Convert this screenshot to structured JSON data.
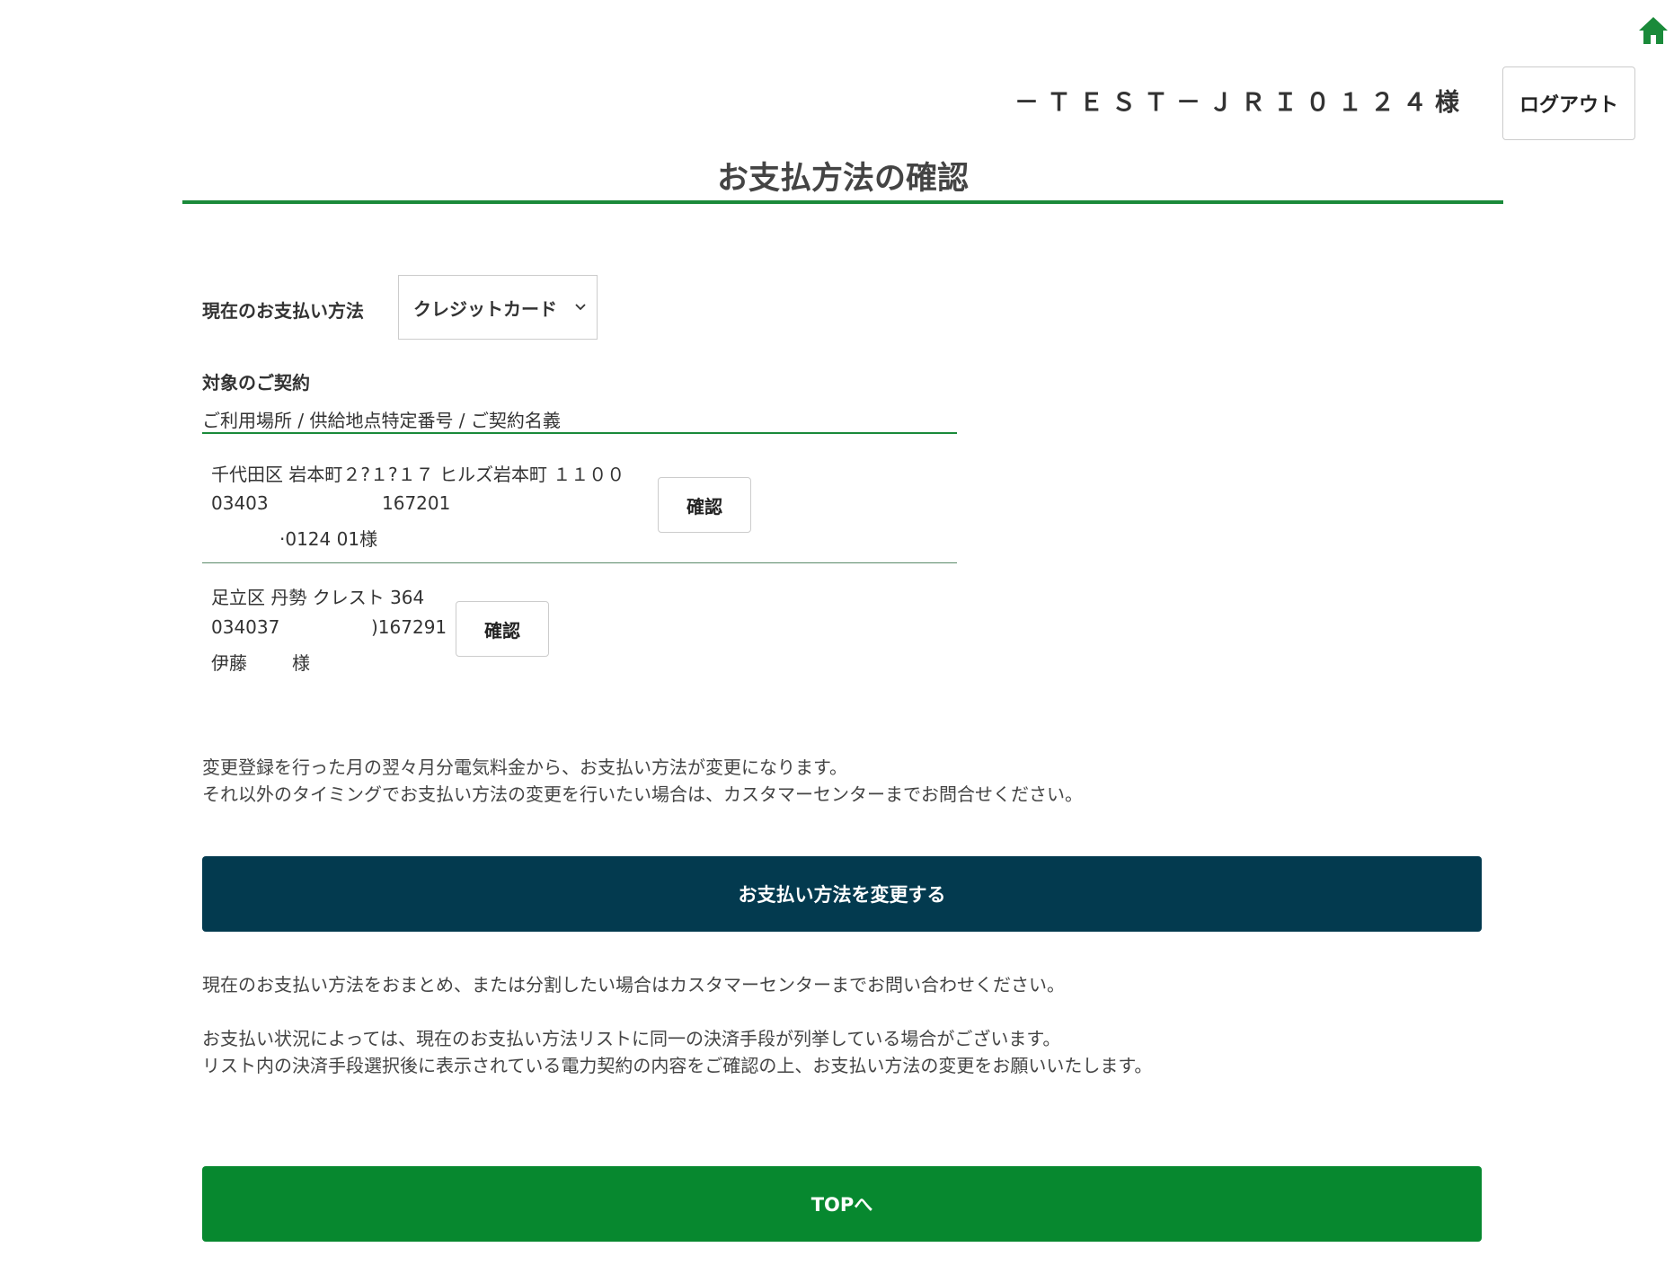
{
  "header": {
    "home_icon": "home-icon",
    "user_name": "－ＴＥＳＴ－ＪＲＩ０１２４様",
    "logout_label": "ログアウト",
    "accent_color": "#1a8a3a"
  },
  "page": {
    "title": "お支払方法の確認"
  },
  "payment_method": {
    "label": "現在のお支払い方法",
    "selected": "クレジットカード"
  },
  "contracts": {
    "label": "対象のご契約",
    "header": "ご利用場所 / 供給地点特定番号 / ご契約名義",
    "items": [
      {
        "address": "千代田区 岩本町２?１?１７ ヒルズ岩本町 １１００",
        "number_start": "03403",
        "number_end": "167201",
        "name": "·0124 01様",
        "confirm_label": "確認"
      },
      {
        "address": "足立区 丹勢 クレスト 364",
        "number_start": "034037",
        "number_end": ")167291",
        "name_start": "伊藤",
        "name_end": "様",
        "confirm_label": "確認"
      }
    ]
  },
  "notices": {
    "line1": "変更登録を行った月の翌々月分電気料金から、お支払い方法が変更になります。",
    "line2": "それ以外のタイミングでお支払い方法の変更を行いたい場合は、カスタマーセンターまでお問合せください。",
    "line3": "現在のお支払い方法をおまとめ、または分割したい場合はカスタマーセンターまでお問い合わせください。",
    "line4": "お支払い状況によっては、現在のお支払い方法リストに同一の決済手段が列挙している場合がございます。",
    "line5": "リスト内の決済手段選択後に表示されている電力契約の内容をご確認の上、お支払い方法の変更をお願いいたします。"
  },
  "actions": {
    "change_label": "お支払い方法を変更する",
    "change_color": "#033a4f",
    "top_label": "TOPへ",
    "top_color": "#07882f"
  }
}
